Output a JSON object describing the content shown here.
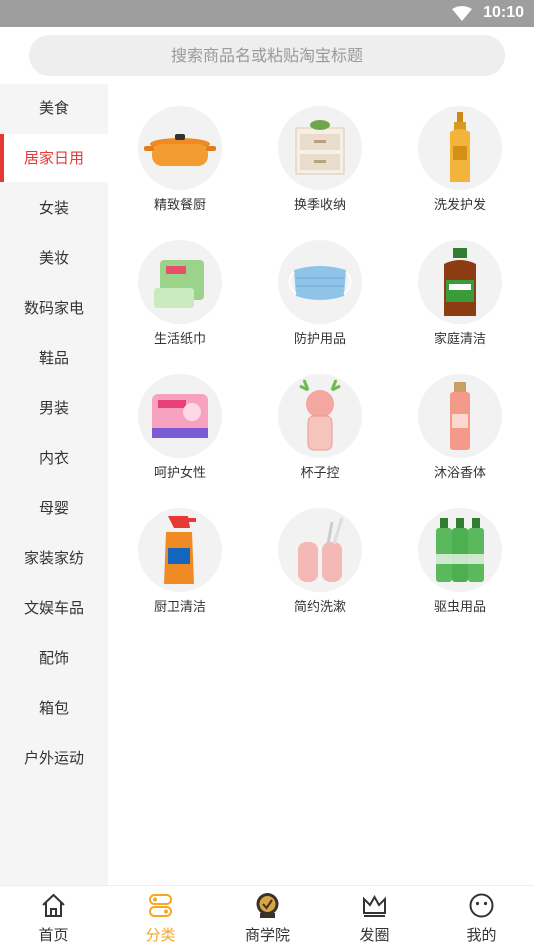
{
  "status": {
    "time": "10:10"
  },
  "search": {
    "placeholder": "搜索商品名或粘贴淘宝标题"
  },
  "sidebar": {
    "items": [
      {
        "label": "美食"
      },
      {
        "label": "居家日用"
      },
      {
        "label": "女装"
      },
      {
        "label": "美妆"
      },
      {
        "label": "数码家电"
      },
      {
        "label": "鞋品"
      },
      {
        "label": "男装"
      },
      {
        "label": "内衣"
      },
      {
        "label": "母婴"
      },
      {
        "label": "家装家纺"
      },
      {
        "label": "文娱车品"
      },
      {
        "label": "配饰"
      },
      {
        "label": "箱包"
      },
      {
        "label": "户外运动"
      }
    ],
    "active_index": 1,
    "active_color": "#e53935"
  },
  "grid": {
    "items": [
      {
        "label": "精致餐厨",
        "icon": "casserole-pot-icon"
      },
      {
        "label": "换季收纳",
        "icon": "storage-drawer-icon"
      },
      {
        "label": "洗发护发",
        "icon": "shampoo-bottle-icon"
      },
      {
        "label": "生活纸巾",
        "icon": "tissue-pack-icon"
      },
      {
        "label": "防护用品",
        "icon": "face-mask-icon"
      },
      {
        "label": "家庭清洁",
        "icon": "disinfectant-bottle-icon"
      },
      {
        "label": "呵护女性",
        "icon": "sanitary-pad-icon"
      },
      {
        "label": "杯子控",
        "icon": "kids-cup-icon"
      },
      {
        "label": "沐浴香体",
        "icon": "body-mist-icon"
      },
      {
        "label": "厨卫清洁",
        "icon": "spray-cleaner-icon"
      },
      {
        "label": "简约洗漱",
        "icon": "toothbrush-cup-icon"
      },
      {
        "label": "驱虫用品",
        "icon": "repellent-bottles-icon"
      }
    ]
  },
  "tabbar": {
    "items": [
      {
        "label": "首页",
        "icon": "home-icon"
      },
      {
        "label": "分类",
        "icon": "category-icon"
      },
      {
        "label": "商学院",
        "icon": "academy-icon"
      },
      {
        "label": "发圈",
        "icon": "crown-icon"
      },
      {
        "label": "我的",
        "icon": "smile-face-icon"
      }
    ],
    "active_index": 1,
    "active_color": "#f5a623"
  }
}
